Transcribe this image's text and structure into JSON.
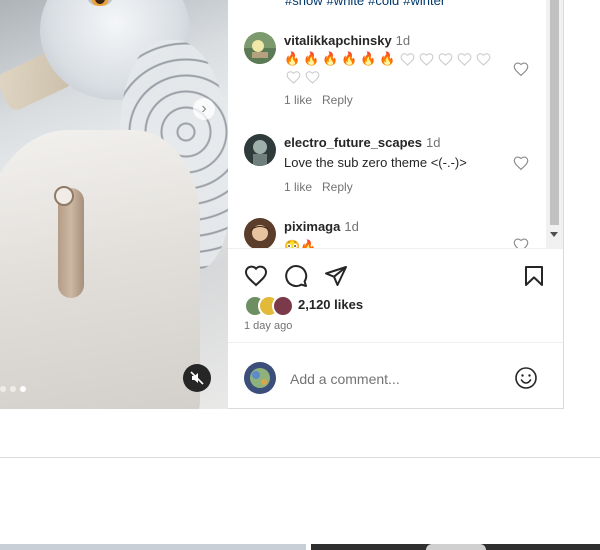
{
  "post": {
    "hashtags": [
      "#snow",
      "#white",
      "#cold",
      "#winter"
    ],
    "media": {
      "next_symbol": "›",
      "slide_count": 3,
      "active_slide": 3
    }
  },
  "comments": [
    {
      "username": "vitalikkapchinsky",
      "time": "1d",
      "fire_count": 6,
      "white_heart_count": 7,
      "likes": "1 like",
      "reply": "Reply"
    },
    {
      "username": "electro_future_scapes",
      "time": "1d",
      "text": "Love the sub zero theme <(-.-)>",
      "likes": "1 like",
      "reply": "Reply"
    },
    {
      "username": "piximaga",
      "time": "1d",
      "text": "😳🔥"
    }
  ],
  "actions": {
    "like_icon": "heart-outline-icon",
    "comment_icon": "speech-bubble-icon",
    "share_icon": "paper-plane-icon",
    "save_icon": "bookmark-icon"
  },
  "likes_label": "2,120 likes",
  "posted_ago": "1 day ago",
  "comment_box": {
    "placeholder": "Add a comment...",
    "emoji_icon": "smiley-icon"
  },
  "colors": {
    "username_text": "#262626",
    "secondary_text": "#737373",
    "hashtag_link": "#00376b",
    "fire": "#f25c05",
    "border": "#dbdbdb"
  }
}
